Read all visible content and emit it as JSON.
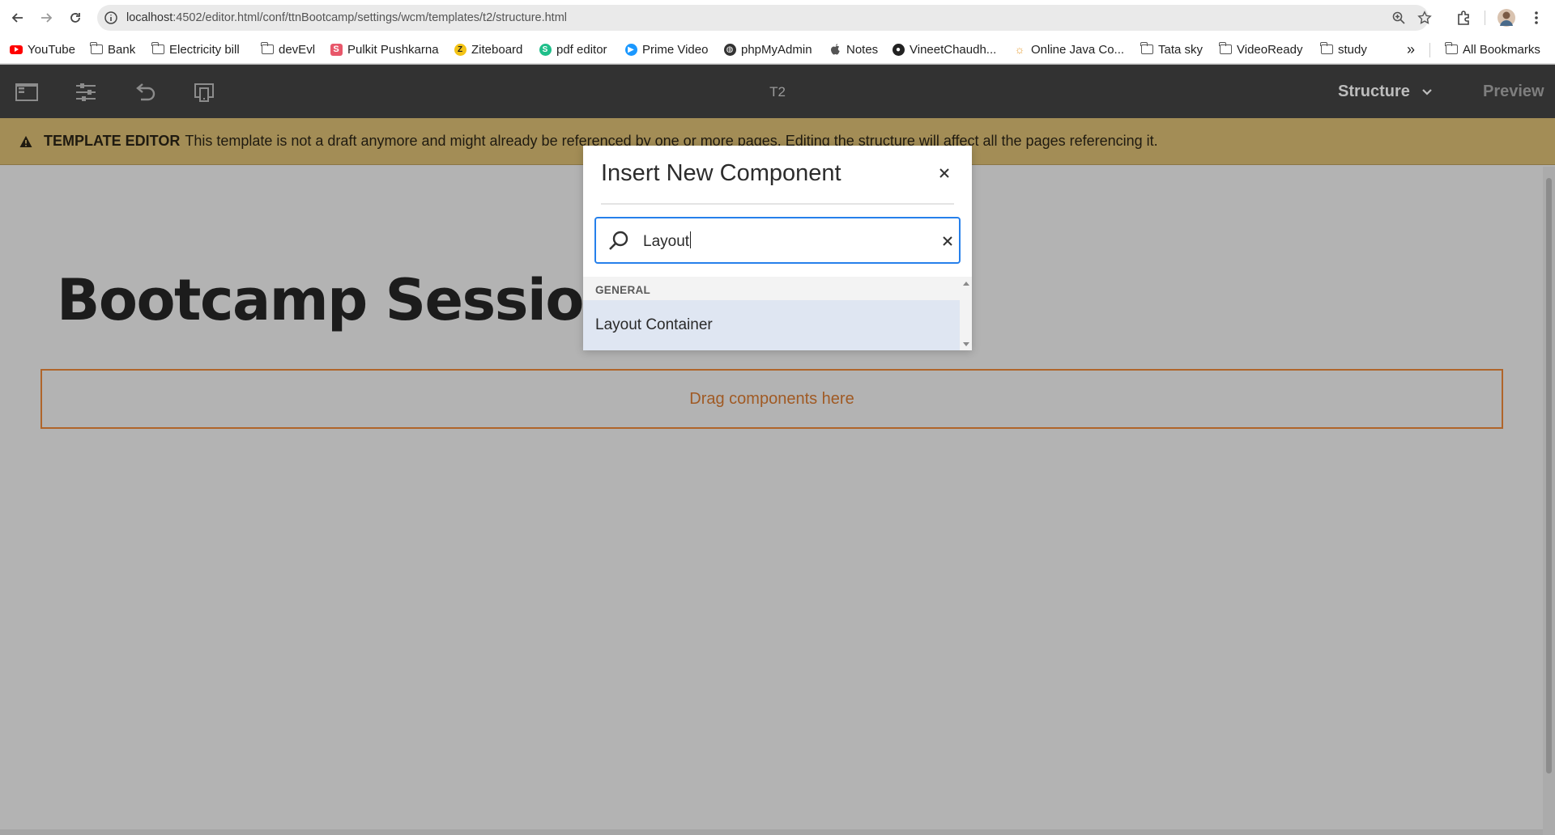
{
  "browser": {
    "url_host": "localhost",
    "url_path": ":4502/editor.html/conf/ttnBootcamp/settings/wcm/templates/t2/structure.html",
    "bookmarks": [
      {
        "label": "YouTube",
        "icon": "youtube-icon"
      },
      {
        "label": "Bank",
        "icon": "folder-icon"
      },
      {
        "label": "Electricity bill",
        "icon": "folder-icon"
      },
      {
        "label": "devEvl",
        "icon": "folder-icon"
      },
      {
        "label": "Pulkit Pushkarna",
        "icon": "site-s-icon"
      },
      {
        "label": "Ziteboard",
        "icon": "ziteboard-icon"
      },
      {
        "label": "pdf editor",
        "icon": "pdf-editor-icon"
      },
      {
        "label": "Prime Video",
        "icon": "prime-video-icon"
      },
      {
        "label": "phpMyAdmin",
        "icon": "globe-icon"
      },
      {
        "label": "Notes",
        "icon": "apple-icon"
      },
      {
        "label": "VineetChaudh...",
        "icon": "github-icon"
      },
      {
        "label": "Online Java Co...",
        "icon": "sun-icon"
      },
      {
        "label": "Tata sky",
        "icon": "folder-icon"
      },
      {
        "label": "VideoReady",
        "icon": "folder-icon"
      },
      {
        "label": "study",
        "icon": "folder-icon"
      }
    ],
    "more_bookmarks": "»",
    "all_bookmarks": "All Bookmarks"
  },
  "editor": {
    "page_name": "T2",
    "mode": "Structure",
    "preview": "Preview"
  },
  "notice": {
    "label": "TEMPLATE EDITOR",
    "message": "This template is not a draft anymore and might already be referenced by one or more pages. Editing the structure will affect all the pages referencing it."
  },
  "canvas": {
    "title": "Bootcamp Session Q",
    "drop_zone": "Drag components here"
  },
  "dialog": {
    "title": "Insert New Component",
    "search_value": "Layout",
    "group": "GENERAL",
    "items": [
      "Layout Container"
    ]
  },
  "colors": {
    "header_bg": "#323232",
    "notice_bg": "#a38d56",
    "accent": "#2680eb",
    "drop_zone": "#b0652a"
  }
}
